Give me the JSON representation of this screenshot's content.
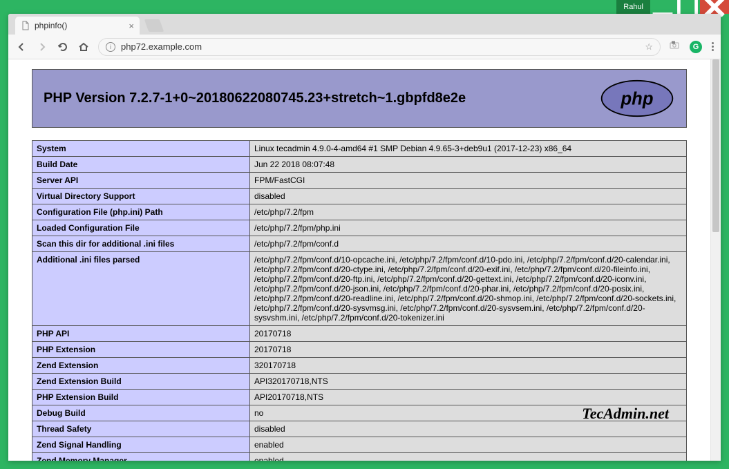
{
  "window": {
    "user": "Rahul"
  },
  "tab": {
    "title": "phpinfo()"
  },
  "address": {
    "url": "php72.example.com"
  },
  "php": {
    "version_heading": "PHP Version 7.2.7-1+0~20180622080745.23+stretch~1.gbpfd8e2e",
    "rows": [
      {
        "k": "System",
        "v": "Linux tecadmin 4.9.0-4-amd64 #1 SMP Debian 4.9.65-3+deb9u1 (2017-12-23) x86_64"
      },
      {
        "k": "Build Date",
        "v": "Jun 22 2018 08:07:48"
      },
      {
        "k": "Server API",
        "v": "FPM/FastCGI"
      },
      {
        "k": "Virtual Directory Support",
        "v": "disabled"
      },
      {
        "k": "Configuration File (php.ini) Path",
        "v": "/etc/php/7.2/fpm"
      },
      {
        "k": "Loaded Configuration File",
        "v": "/etc/php/7.2/fpm/php.ini"
      },
      {
        "k": "Scan this dir for additional .ini files",
        "v": "/etc/php/7.2/fpm/conf.d"
      },
      {
        "k": "Additional .ini files parsed",
        "v": "/etc/php/7.2/fpm/conf.d/10-opcache.ini, /etc/php/7.2/fpm/conf.d/10-pdo.ini, /etc/php/7.2/fpm/conf.d/20-calendar.ini, /etc/php/7.2/fpm/conf.d/20-ctype.ini, /etc/php/7.2/fpm/conf.d/20-exif.ini, /etc/php/7.2/fpm/conf.d/20-fileinfo.ini, /etc/php/7.2/fpm/conf.d/20-ftp.ini, /etc/php/7.2/fpm/conf.d/20-gettext.ini, /etc/php/7.2/fpm/conf.d/20-iconv.ini, /etc/php/7.2/fpm/conf.d/20-json.ini, /etc/php/7.2/fpm/conf.d/20-phar.ini, /etc/php/7.2/fpm/conf.d/20-posix.ini, /etc/php/7.2/fpm/conf.d/20-readline.ini, /etc/php/7.2/fpm/conf.d/20-shmop.ini, /etc/php/7.2/fpm/conf.d/20-sockets.ini, /etc/php/7.2/fpm/conf.d/20-sysvmsg.ini, /etc/php/7.2/fpm/conf.d/20-sysvsem.ini, /etc/php/7.2/fpm/conf.d/20-sysvshm.ini, /etc/php/7.2/fpm/conf.d/20-tokenizer.ini"
      },
      {
        "k": "PHP API",
        "v": "20170718"
      },
      {
        "k": "PHP Extension",
        "v": "20170718"
      },
      {
        "k": "Zend Extension",
        "v": "320170718"
      },
      {
        "k": "Zend Extension Build",
        "v": "API320170718,NTS"
      },
      {
        "k": "PHP Extension Build",
        "v": "API20170718,NTS"
      },
      {
        "k": "Debug Build",
        "v": "no"
      },
      {
        "k": "Thread Safety",
        "v": "disabled"
      },
      {
        "k": "Zend Signal Handling",
        "v": "enabled"
      },
      {
        "k": "Zend Memory Manager",
        "v": "enabled"
      }
    ]
  },
  "watermark": "TecAdmin.net"
}
